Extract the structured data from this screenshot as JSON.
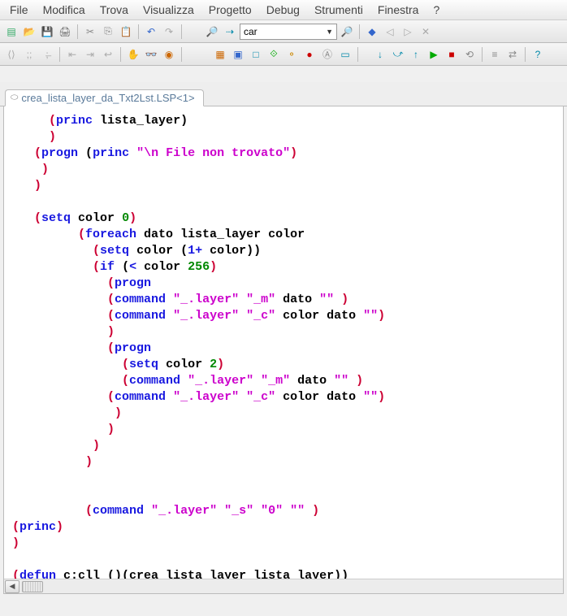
{
  "menu": {
    "file": "File",
    "edit": "Modifica",
    "find": "Trova",
    "view": "Visualizza",
    "project": "Progetto",
    "debug": "Debug",
    "tools": "Strumenti",
    "window": "Finestra",
    "help": "?"
  },
  "toolbar": {
    "search_value": "car"
  },
  "tab": {
    "title": "crea_lista_layer_da_Txt2Lst.LSP<1>"
  },
  "code": {
    "l1a": "(",
    "l1b": "princ",
    "l1c": " lista_layer)",
    "l2a": ")",
    "l3a": "(",
    "l3b": "progn",
    "l3c": " (",
    "l3d": "princ",
    "l3e": " ",
    "l3f": "\"\\n File non trovato\"",
    "l3g": ")",
    "l4a": ")",
    "l5a": ")",
    "l6a": "(",
    "l6b": "setq",
    "l6c": " color ",
    "l6d": "0",
    "l6e": ")",
    "l7a": "(",
    "l7b": "foreach",
    "l7c": " dato lista_layer color",
    "l8a": "(",
    "l8b": "setq",
    "l8c": " color (",
    "l8d": "1+",
    "l8e": " color))",
    "l9a": "(",
    "l9b": "if",
    "l9c": " (",
    "l9d": "<",
    "l9e": " color ",
    "l9f": "256",
    "l9g": ")",
    "l10a": "(",
    "l10b": "progn",
    "l11a": "(",
    "l11b": "command",
    "l11c": " ",
    "l11d": "\"_.layer\"",
    "l11e": " ",
    "l11f": "\"_m\"",
    "l11g": " dato ",
    "l11h": "\"\"",
    "l11i": " )",
    "l12a": "(",
    "l12b": "command",
    "l12c": " ",
    "l12d": "\"_.layer\"",
    "l12e": " ",
    "l12f": "\"_c\"",
    "l12g": " color dato ",
    "l12h": "\"\"",
    "l12i": ")",
    "l13a": ")",
    "l14a": "(",
    "l14b": "progn",
    "l15a": "(",
    "l15b": "setq",
    "l15c": " color ",
    "l15d": "2",
    "l15e": ")",
    "l16a": "(",
    "l16b": "command",
    "l16c": " ",
    "l16d": "\"_.layer\"",
    "l16e": " ",
    "l16f": "\"_m\"",
    "l16g": " dato ",
    "l16h": "\"\"",
    "l16i": " )",
    "l17a": "(",
    "l17b": "command",
    "l17c": " ",
    "l17d": "\"_.layer\"",
    "l17e": " ",
    "l17f": "\"_c\"",
    "l17g": " color dato ",
    "l17h": "\"\"",
    "l17i": ")",
    "l18a": ")",
    "l19a": ")",
    "l20a": ")",
    "l21a": ")",
    "l22a": "(",
    "l22b": "command",
    "l22c": " ",
    "l22d": "\"_.layer\"",
    "l22e": " ",
    "l22f": "\"_s\"",
    "l22g": " ",
    "l22h": "\"0\"",
    "l22i": " ",
    "l22j": "\"\"",
    "l22k": " )",
    "l23a": "(",
    "l23b": "princ",
    "l23c": ")",
    "l24a": ")",
    "l25a": "(",
    "l25b": "defun",
    "l25c": " c:cll ()(crea_lista_layer lista_layer))"
  }
}
